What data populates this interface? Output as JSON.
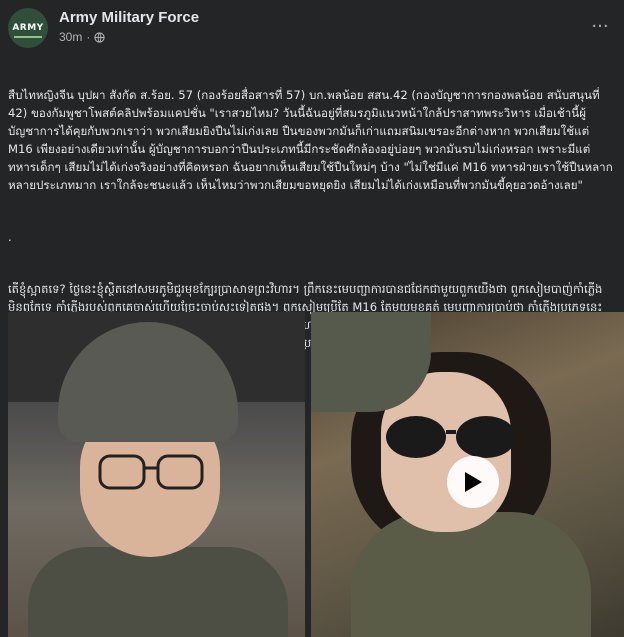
{
  "post": {
    "page_name": "Army Military Force",
    "timestamp": "30m",
    "avatar_text": "ARMY",
    "paragraph_thai": "สืบไทหญิงจีน บุปผา สังกัด ส.ร้อย. 57 (กองร้อยสื่อสารที่ 57) บก.พลน้อย สสน.42 (กองบัญชาการกองพลน้อย สนับสนุนที่ 42) ของกัมพูชาโพสต์คลิปพร้อมแคปชั่น \"เราสวยไหม? วันนี้ฉันอยู่ที่สมรภูมิแนวหน้าใกล้ปราสาทพระวิหาร เมื่อเช้านี้ผู้บัญชาการได้คุยกับพวกเราว่า พวกเสียมยิงปืนไม่เก่งเลย ปืนของพวกมันก็เก่าแถมสนิมเขรอะอีกต่างหาก พวกเสียมใช้แต่ M16 เพียงอย่างเดียวเท่านั้น ผู้บัญชาการบอกว่าปืนประเภทนี้มีกระชัดศักล้องอยู่บ่อยๆ พวกมันรบไม่เก่งหรอก เพราะมีแต่ทหารเด็กๆ เสียมไม่ได้เก่งจริงอย่างที่คิดหรอก ฉันอยากเห็นเสียมใช้ปืนใหม่ๆ บ้าง \"ไม่ใช่มีแค่ M16 ทหารฝ่ายเราใช้ปืนหลากหลายประเภทมาก เราใกล้จะชนะแล้ว เห็นไหมว่าพวกเสียมขอหยุดยิง เสียมไม่ได้เก่งเหมือนที่พวกมันขี้คุยอวดอ้างเลย\"",
    "separator": ".",
    "paragraph_khmer": "តើខ្ញុំស្អាតទេ? ថ្ងៃនេះខ្ញុំស្ថិតនៅសមរភូមិជួរមុខក្បែរប្រាសាទព្រះវិហារ។ ព្រឹកនេះមេបញ្ជាការបានជជែកជាមួយពួកយើងថា ពួកសៀមបាញ់កាំភ្លើងមិនពូកែទេ កាំភ្លើងរបស់ពួកគេចាស់ហើយច្រែះចាប់សុះទៀតផង។ ពួកសៀមប្រើតែ M16 តែមួយមុខគត់ មេបញ្ជាការប្រាប់ថា កាំភ្លើងប្រភេទនេះច្រើនតែគាំងគ្រាប់ជាញឹកញាប់។ ពួកគេមិនពូកែច្បាំងទេ ព្រោះមានតែទាហានក្មេងៗ សៀមមិនខ្លាំងពិតប្រាកដទេ។ ចង់ឃើញសៀមប្រើកាំភ្លើងថ្មីៗខ្លះ មិនមែនមានតែ M16 នោះទេ។ ទាហានខាងយើងប្រើកាំភ្លើងច្រើនប្រភេទណាស់ យើងជិតឈ្នះហើយ ឃើញទេពួកសៀមសុំឈប់បាញ់ សៀមមិនបានខ្លាំងដូចដែលពួកគាត់អួតនោះឡើយ។"
  },
  "icons": {
    "more": "more-options-icon",
    "globe": "globe-icon",
    "play": "play-icon",
    "expand": "expand-icon"
  },
  "colors": {
    "background": "#242526",
    "text": "#e4e6eb",
    "secondary_text": "#b0b3b8"
  }
}
